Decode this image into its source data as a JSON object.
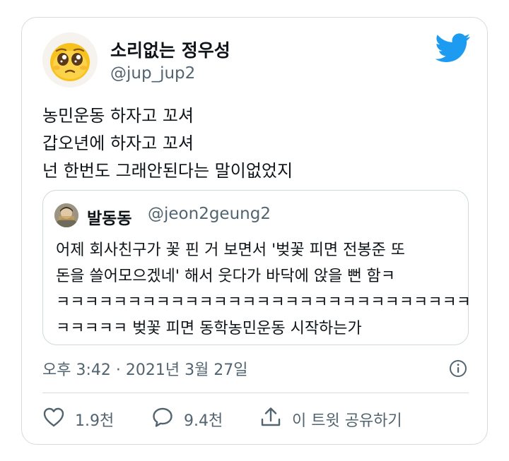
{
  "author": {
    "display_name": "소리없는 정우성",
    "handle": "@jup_jup2"
  },
  "tweet": {
    "lines": [
      "농민운동 하자고 꼬셔",
      "갑오년에 하자고 꼬셔",
      "넌 한번도 그래안된다는 말이없었지"
    ]
  },
  "quoted_tweet": {
    "display_name": "발동동",
    "handle": "@jeon2geung2",
    "lines": [
      "어제 회사친구가 꽃 핀 거 보면서 '벚꽃 피면 전봉준 또",
      "돈을 쓸어모으겠네' 해서 웃다가 바닥에 앉을 뻔 함ㅋ",
      "ㅋㅋㅋㅋㅋㅋㅋㅋㅋㅋㅋㅋㅋㅋㅋㅋㅋㅋㅋㅋㅋㅋㅋㅋㅋㅋㅋㅋㅋ",
      "ㅋㅋㅋㅋㅋ 벚꽃 피면 동학농민운동 시작하는가"
    ]
  },
  "meta": {
    "timestamp": "오후 3:42 · 2021년 3월 27일"
  },
  "actions": {
    "like_count": "1.9천",
    "reply_count": "9.4천",
    "share_label": "이 트윗 공유하기"
  },
  "icons": {
    "brand": "twitter-bird-icon",
    "info": "info-icon",
    "like": "heart-icon",
    "reply": "speech-bubble-icon",
    "share": "share-upload-icon"
  },
  "colors": {
    "twitter_blue": "#1d9bf0",
    "text_primary": "#0f1419",
    "text_secondary": "#536471",
    "border": "#d6dbe0"
  }
}
